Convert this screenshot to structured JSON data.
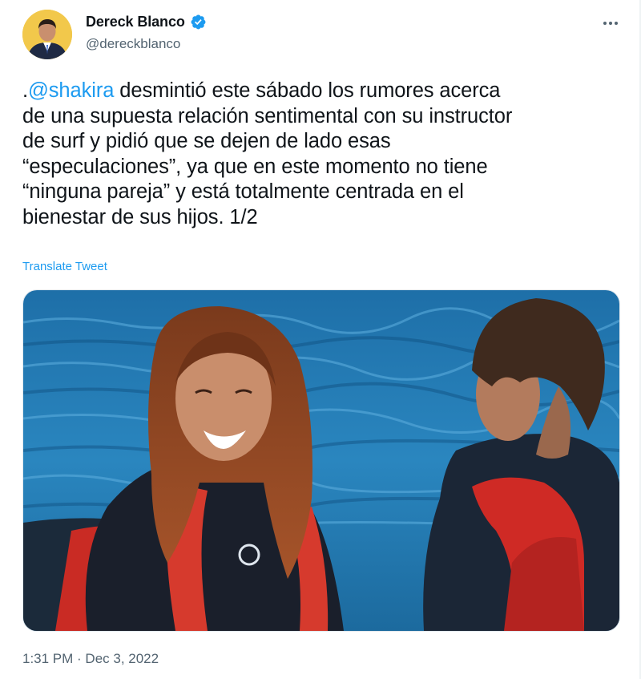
{
  "author": {
    "name": "Dereck Blanco",
    "handle": "@dereckblanco",
    "verified": true,
    "avatar_icon": "user-avatar"
  },
  "more_icon": "more-horizontal-icon",
  "tweet": {
    "lines": [
      {
        "prefix": ".",
        "mention": "@shakira",
        "rest": " desmintió este sábado los rumores acerca"
      },
      {
        "text": "de una supuesta relación sentimental con su instructor"
      },
      {
        "text": "de surf y pidió que se dejen de lado esas"
      },
      {
        "text": "“especulaciones”, ya que en este momento no tiene"
      },
      {
        "text": "“ninguna pareja” y está totalmente centrada en el"
      },
      {
        "text": "bienestar de sus hijos. 1/2"
      }
    ]
  },
  "translate_label": "Translate Tweet",
  "media": {
    "kind": "photo"
  },
  "timestamp": "1:31 PM · Dec 3, 2022",
  "colors": {
    "accent": "#1d9bf0",
    "text": "#0f1419",
    "secondary": "#536471"
  }
}
